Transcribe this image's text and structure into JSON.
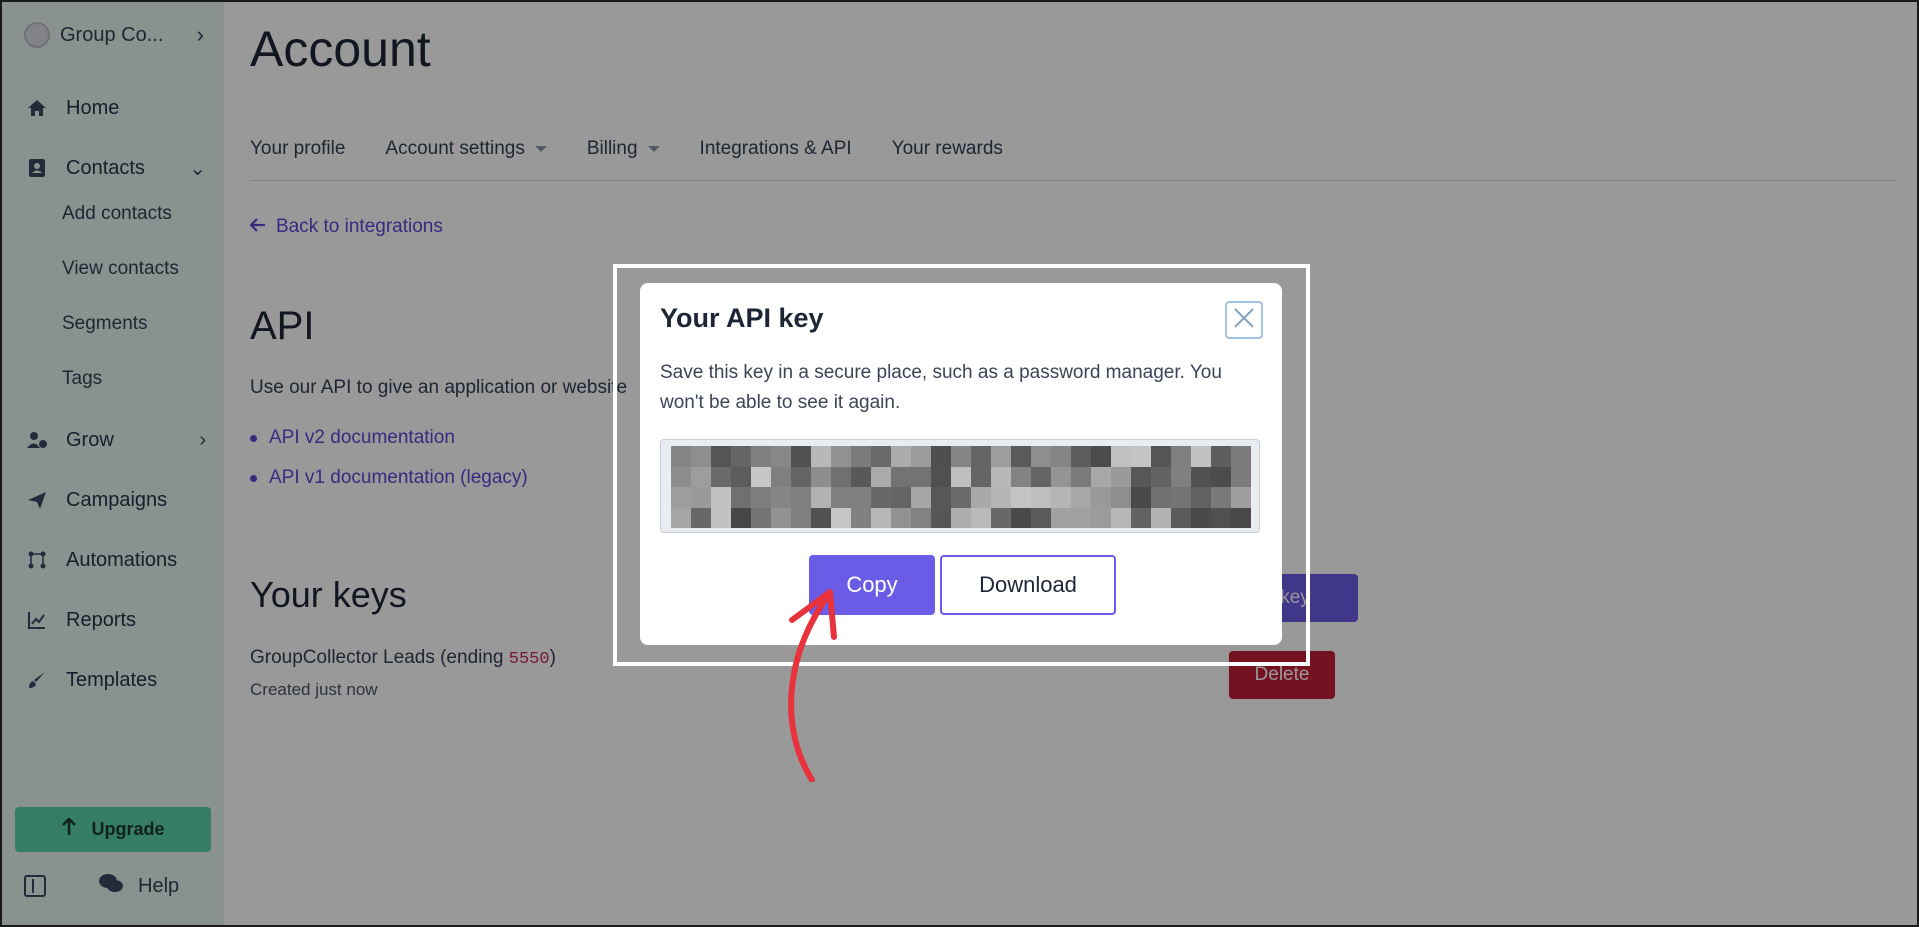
{
  "sidebar": {
    "workspace_name": "Group Co...",
    "items": [
      {
        "label": "Home",
        "icon": "home-icon"
      },
      {
        "label": "Contacts",
        "icon": "contacts-icon"
      },
      {
        "label": "Grow",
        "icon": "grow-icon"
      },
      {
        "label": "Campaigns",
        "icon": "campaigns-icon"
      },
      {
        "label": "Automations",
        "icon": "automations-icon"
      },
      {
        "label": "Reports",
        "icon": "reports-icon"
      },
      {
        "label": "Templates",
        "icon": "templates-icon"
      }
    ],
    "contacts_subitems": [
      "Add contacts",
      "View contacts",
      "Segments",
      "Tags"
    ],
    "upgrade_label": "Upgrade",
    "help_label": "Help"
  },
  "page": {
    "title": "Account",
    "tabs": [
      "Your profile",
      "Account settings",
      "Billing",
      "Integrations & API",
      "Your rewards"
    ],
    "back_link": "Back to integrations",
    "api_heading": "API",
    "api_description": "Use our API to give an application or website",
    "doc_links": [
      "API v2 documentation",
      "API v1 documentation (legacy)"
    ],
    "keys_heading": "Your keys",
    "key_name_prefix": "GroupCollector Leads (ending ",
    "key_suffix_code": "5550",
    "key_name_close": ")",
    "key_created": "Created just now",
    "new_key_button": "key",
    "delete_button": "Delete"
  },
  "modal": {
    "title": "Your API key",
    "body": "Save this key in a secure place, such as a password manager. You won't be able to see it again.",
    "copy_label": "Copy",
    "download_label": "Download"
  },
  "colors": {
    "accent": "#6b5ce7",
    "sidebar_bg": "#e6f4ef",
    "danger": "#c21f3a",
    "upgrade": "#59d0a8",
    "annotation_arrow": "#e8323c"
  }
}
